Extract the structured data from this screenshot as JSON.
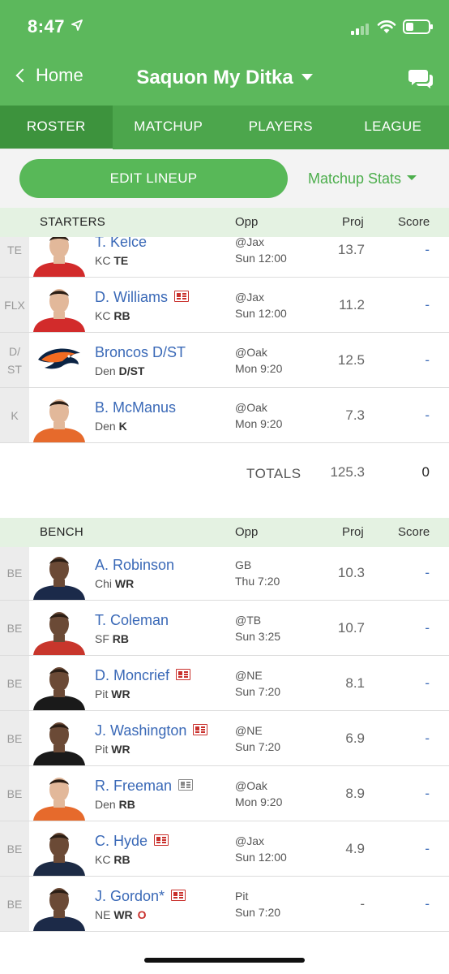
{
  "status_bar": {
    "time": "8:47"
  },
  "nav": {
    "back_label": "Home",
    "title": "Saquon My Ditka"
  },
  "tabs": [
    {
      "label": "ROSTER",
      "active": true
    },
    {
      "label": "MATCHUP",
      "active": false
    },
    {
      "label": "PLAYERS",
      "active": false
    },
    {
      "label": "LEAGUE",
      "active": false
    }
  ],
  "actions": {
    "edit_lineup": "EDIT LINEUP",
    "matchup_stats": "Matchup Stats"
  },
  "starters": {
    "header": {
      "label": "STARTERS",
      "opp": "Opp",
      "proj": "Proj",
      "score": "Score"
    },
    "rows": [
      {
        "slot": "TE",
        "name": "T. Kelce",
        "team": "KC",
        "pos": "TE",
        "opp": "@Jax",
        "time": "Sun 12:00",
        "proj": "13.7",
        "score": "-",
        "news": "",
        "photo": "kc"
      },
      {
        "slot": "FLX",
        "name": "D. Williams",
        "team": "KC",
        "pos": "RB",
        "opp": "@Jax",
        "time": "Sun 12:00",
        "proj": "11.2",
        "score": "-",
        "news": "red",
        "photo": "kc"
      },
      {
        "slot": "D/ ST",
        "name": "Broncos D/ST",
        "team": "Den",
        "pos": "D/ST",
        "opp": "@Oak",
        "time": "Mon 9:20",
        "proj": "12.5",
        "score": "-",
        "news": "",
        "photo": "logo"
      },
      {
        "slot": "K",
        "name": "B. McManus",
        "team": "Den",
        "pos": "K",
        "opp": "@Oak",
        "time": "Mon 9:20",
        "proj": "7.3",
        "score": "-",
        "news": "",
        "photo": "den"
      }
    ],
    "totals": {
      "label": "TOTALS",
      "proj": "125.3",
      "score": "0"
    }
  },
  "bench": {
    "header": {
      "label": "BENCH",
      "opp": "Opp",
      "proj": "Proj",
      "score": "Score"
    },
    "rows": [
      {
        "slot": "BE",
        "name": "A. Robinson",
        "team": "Chi",
        "pos": "WR",
        "opp": "GB",
        "time": "Thu 7:20",
        "proj": "10.3",
        "score": "-",
        "news": "",
        "photo": "chi"
      },
      {
        "slot": "BE",
        "name": "T. Coleman",
        "team": "SF",
        "pos": "RB",
        "opp": "@TB",
        "time": "Sun 3:25",
        "proj": "10.7",
        "score": "-",
        "news": "",
        "photo": "sf"
      },
      {
        "slot": "BE",
        "name": "D. Moncrief",
        "team": "Pit",
        "pos": "WR",
        "opp": "@NE",
        "time": "Sun 7:20",
        "proj": "8.1",
        "score": "-",
        "news": "red",
        "photo": "pit"
      },
      {
        "slot": "BE",
        "name": "J. Washington",
        "team": "Pit",
        "pos": "WR",
        "opp": "@NE",
        "time": "Sun 7:20",
        "proj": "6.9",
        "score": "-",
        "news": "red",
        "photo": "pit"
      },
      {
        "slot": "BE",
        "name": "R. Freeman",
        "team": "Den",
        "pos": "RB",
        "opp": "@Oak",
        "time": "Mon 9:20",
        "proj": "8.9",
        "score": "-",
        "news": "gray",
        "photo": "den"
      },
      {
        "slot": "BE",
        "name": "C. Hyde",
        "team": "KC",
        "pos": "RB",
        "opp": "@Jax",
        "time": "Sun 12:00",
        "proj": "4.9",
        "score": "-",
        "news": "red",
        "photo": "navy"
      },
      {
        "slot": "BE",
        "name": "J. Gordon*",
        "team": "NE",
        "pos": "WR",
        "status": "O",
        "opp": "Pit",
        "time": "Sun 7:20",
        "proj": "-",
        "score": "-",
        "news": "red",
        "photo": "ne"
      }
    ]
  },
  "colors": {
    "brand_green": "#5cb85c",
    "tab_green": "#4ca64c",
    "link_blue": "#3a69b7",
    "injury_red": "#c9302c"
  }
}
